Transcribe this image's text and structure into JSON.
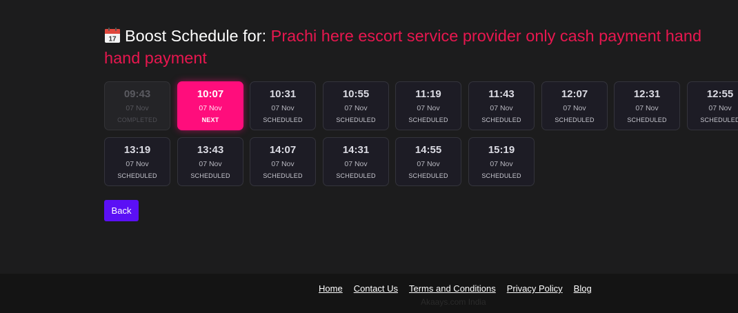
{
  "page": {
    "title_prefix": "Boost Schedule for:",
    "title_name_line1": "Prachi here escort service provider only cash payment hand",
    "title_name_line2": "hand payment",
    "icon": "calendar-icon",
    "icon_day": "17",
    "colors": {
      "accent_title": "#e8174f",
      "next_slot": "#ff0d7c",
      "back_button": "#5b10f5"
    }
  },
  "slots": [
    {
      "time": "09:43",
      "date": "07 Nov",
      "status": "COMPLETED",
      "state": "completed"
    },
    {
      "time": "10:07",
      "date": "07 Nov",
      "status": "NEXT",
      "state": "next"
    },
    {
      "time": "10:31",
      "date": "07 Nov",
      "status": "SCHEDULED",
      "state": "scheduled"
    },
    {
      "time": "10:55",
      "date": "07 Nov",
      "status": "SCHEDULED",
      "state": "scheduled"
    },
    {
      "time": "11:19",
      "date": "07 Nov",
      "status": "SCHEDULED",
      "state": "scheduled"
    },
    {
      "time": "11:43",
      "date": "07 Nov",
      "status": "SCHEDULED",
      "state": "scheduled"
    },
    {
      "time": "12:07",
      "date": "07 Nov",
      "status": "SCHEDULED",
      "state": "scheduled"
    },
    {
      "time": "12:31",
      "date": "07 Nov",
      "status": "SCHEDULED",
      "state": "scheduled"
    },
    {
      "time": "12:55",
      "date": "07 Nov",
      "status": "SCHEDULED",
      "state": "scheduled"
    },
    {
      "time": "13:19",
      "date": "07 Nov",
      "status": "SCHEDULED",
      "state": "scheduled"
    },
    {
      "time": "13:43",
      "date": "07 Nov",
      "status": "SCHEDULED",
      "state": "scheduled"
    },
    {
      "time": "14:07",
      "date": "07 Nov",
      "status": "SCHEDULED",
      "state": "scheduled"
    },
    {
      "time": "14:31",
      "date": "07 Nov",
      "status": "SCHEDULED",
      "state": "scheduled"
    },
    {
      "time": "14:55",
      "date": "07 Nov",
      "status": "SCHEDULED",
      "state": "scheduled"
    },
    {
      "time": "15:19",
      "date": "07 Nov",
      "status": "SCHEDULED",
      "state": "scheduled"
    }
  ],
  "actions": {
    "back_label": "Back"
  },
  "footer": {
    "links": [
      "Home",
      "Contact Us",
      "Terms and Conditions",
      "Privacy Policy",
      "Blog"
    ],
    "copyright": "Akaays.com India"
  }
}
